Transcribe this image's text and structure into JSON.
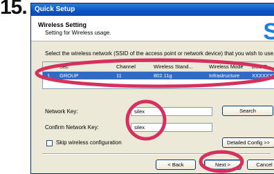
{
  "step_number": "15.",
  "window": {
    "title": "Quick Setup",
    "header": {
      "title": "Wireless Setting",
      "subtitle": "Setting for Wireless usage."
    },
    "instruction": "Select the wireless network (SSID of the access point or network device) that you wish to use."
  },
  "network_list": {
    "columns": [
      "Sec",
      "Channel",
      "Wireless Stand...",
      "Wireless Mode",
      "BSSID"
    ],
    "rows": [
      {
        "index": "1",
        "name": "GROUP",
        "channel": "11",
        "standard": "802.11g",
        "mode": "Infrastructure",
        "bssid": "XXXXXXXXXXXX"
      }
    ]
  },
  "form": {
    "network_key_label": "Network Key:",
    "network_key_value": "silex",
    "confirm_key_label": "Confirm Network Key:",
    "confirm_key_value": "silex",
    "skip_label": "Skip wireless configuration"
  },
  "buttons": {
    "search": "Search",
    "detailed_config": "Detailed Config >>",
    "back": "< Back",
    "next": "Next >",
    "cancel": "Cancel"
  },
  "colors": {
    "highlight_ring": "#d6305e",
    "selection": "#316ac5",
    "titlebar": "#0a56c8"
  }
}
